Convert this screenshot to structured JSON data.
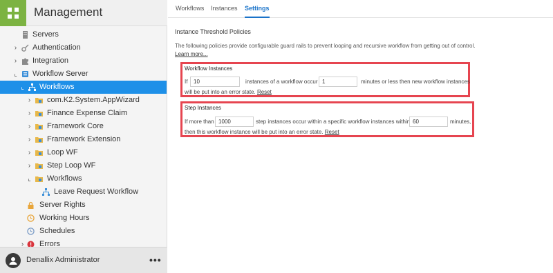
{
  "sidebar": {
    "title": "Management",
    "tree": [
      {
        "label": "Servers",
        "icon": "server-icon",
        "toggle": ""
      },
      {
        "label": "Authentication",
        "icon": "key-icon",
        "toggle": "›"
      },
      {
        "label": "Integration",
        "icon": "puzzle-icon",
        "toggle": "›"
      },
      {
        "label": "Workflow Server",
        "icon": "workflow-server-icon",
        "toggle": "⌞"
      },
      {
        "label": "Workflows",
        "icon": "workflow-tree-icon",
        "toggle": "⌞"
      },
      {
        "label": "com.K2.System.AppWizard",
        "icon": "folder-icon",
        "toggle": "›"
      },
      {
        "label": "Finance Expense Claim",
        "icon": "folder-icon",
        "toggle": "›"
      },
      {
        "label": "Framework Core",
        "icon": "folder-icon",
        "toggle": "›"
      },
      {
        "label": "Framework Extension",
        "icon": "folder-icon",
        "toggle": "›"
      },
      {
        "label": "Loop WF",
        "icon": "folder-icon",
        "toggle": "›"
      },
      {
        "label": "Step Loop WF",
        "icon": "folder-icon",
        "toggle": "›"
      },
      {
        "label": "Workflows",
        "icon": "folder-icon",
        "toggle": "⌞"
      },
      {
        "label": "Leave Request Workflow",
        "icon": "workflow-tree-icon",
        "toggle": ""
      },
      {
        "label": "Server Rights",
        "icon": "lock-icon",
        "toggle": ""
      },
      {
        "label": "Working Hours",
        "icon": "clock-icon",
        "toggle": ""
      },
      {
        "label": "Schedules",
        "icon": "schedule-icon",
        "toggle": ""
      },
      {
        "label": "Errors",
        "icon": "error-icon",
        "toggle": "›"
      }
    ],
    "user_name": "Denallix Administrator",
    "more_label": "•••"
  },
  "tabs": [
    {
      "label": "Workflows"
    },
    {
      "label": "Instances"
    },
    {
      "label": "Settings"
    }
  ],
  "settings": {
    "section_title": "Instance Threshold Policies",
    "description": "The following policies provide configurable guard rails to prevent looping and recursive workflow from getting out of control.",
    "learn_more": "Learn more...",
    "workflow_instances": {
      "title": "Workflow Instances",
      "if_label": "If",
      "count_value": "10",
      "mid_text": "instances of a workflow occur within",
      "minutes_value": "1",
      "tail_text": "minutes or less then new workflow instances",
      "line2_text": "will be put into an error state.",
      "reset_label": "Reset"
    },
    "step_instances": {
      "title": "Step Instances",
      "if_label": "If more than",
      "count_value": "1000",
      "mid_text": "step instances occur within a specific workflow instances within",
      "minutes_value": "60",
      "tail_text": "minutes,",
      "line2_text": "then this workflow instance will be put into an error state.",
      "reset_label": "Reset"
    }
  },
  "colors": {
    "accent": "#1e90e8",
    "logo": "#7cb342",
    "highlight_border": "#e64550"
  }
}
